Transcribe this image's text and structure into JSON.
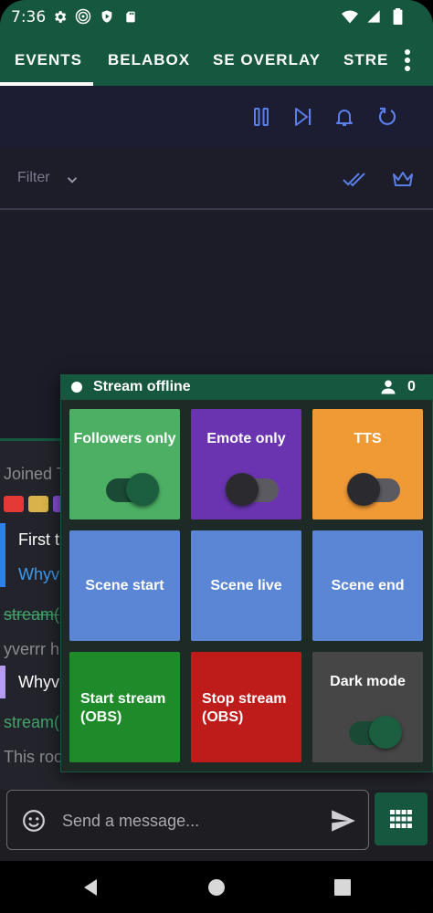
{
  "status_bar": {
    "time": "7:36",
    "icons_left": [
      "gear-icon",
      "spiral-icon",
      "shield-icon",
      "sd-card-icon"
    ],
    "icons_right": [
      "wifi-icon",
      "signal-icon",
      "battery-icon"
    ]
  },
  "tabs": [
    {
      "label": "EVENTS",
      "active": true
    },
    {
      "label": "BELABOX",
      "active": false
    },
    {
      "label": "SE OVERLAY",
      "active": false
    },
    {
      "label": "STRE",
      "active": false
    }
  ],
  "toolbar": {
    "icons": [
      "pause-icon",
      "skip-next-icon",
      "bell-icon",
      "refresh-icon"
    ],
    "accent": "#5b7fe8"
  },
  "filter": {
    "label": "Filter",
    "icons": [
      "double-check-icon",
      "crown-icon"
    ]
  },
  "chat": {
    "lines": [
      {
        "text": "Joined T"
      },
      {
        "text": "First t"
      },
      {
        "text": "Whyv"
      },
      {
        "text": "stream("
      },
      {
        "text": "yverrr h"
      },
      {
        "text": "Whyv"
      },
      {
        "text": "stream("
      },
      {
        "text": "This roo"
      }
    ]
  },
  "stream_dialog": {
    "status": "Stream offline",
    "viewer_count": "0",
    "tiles": [
      {
        "label": "Followers only",
        "color": "#4caf64",
        "toggle": true,
        "toggle_on": true
      },
      {
        "label": "Emote only",
        "color": "#6a34b0",
        "toggle": true,
        "toggle_on": false
      },
      {
        "label": "TTS",
        "color": "#f09a36",
        "toggle": true,
        "toggle_on": false
      },
      {
        "label": "Scene start",
        "color": "#5b86d6",
        "toggle": false
      },
      {
        "label": "Scene live",
        "color": "#5b86d6",
        "toggle": false
      },
      {
        "label": "Scene end",
        "color": "#5b86d6",
        "toggle": false
      },
      {
        "label": "Start stream (OBS)",
        "color": "#1e8a2a",
        "toggle": false
      },
      {
        "label": "Stop stream (OBS)",
        "color": "#be1b1b",
        "toggle": false
      },
      {
        "label": "Dark mode",
        "color": "#464646",
        "toggle": true,
        "toggle_on": true
      }
    ]
  },
  "message_bar": {
    "placeholder": "Send a message...",
    "icons": [
      "emoji-icon",
      "send-icon",
      "keypad-icon"
    ]
  },
  "nav": {
    "icons": [
      "back-icon",
      "home-icon",
      "recents-icon"
    ]
  }
}
